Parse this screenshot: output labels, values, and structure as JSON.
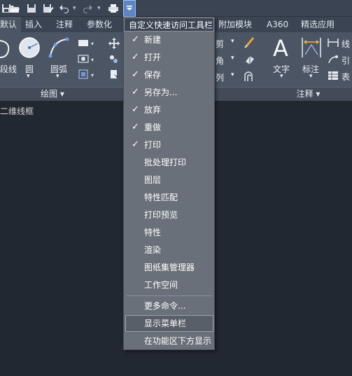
{
  "quick_access": {
    "icons": [
      "save-icon",
      "open-icon",
      "save-as-icon",
      "undo-icon",
      "redo-icon",
      "plot-icon"
    ],
    "dropdown_icon": "chevron-down-icon"
  },
  "tabs": [
    {
      "label": "默认"
    },
    {
      "label": "插入"
    },
    {
      "label": "注释"
    },
    {
      "label": "参数化"
    },
    {
      "label": "附加模块"
    },
    {
      "label": "A360"
    },
    {
      "label": "精选应用"
    }
  ],
  "ribbon": {
    "draw": {
      "polyline_label": "段线",
      "circle_label": "圆",
      "arc_label": "圆弧",
      "panel_label": "绘图 ▾"
    },
    "modify": {
      "trim_label": "剪",
      "fillet_label": "角",
      "array_label": "列"
    },
    "annotation": {
      "text_label": "文字",
      "dimension_label": "标注",
      "linear_label": "线",
      "leader_label": "引",
      "table_label": "表",
      "panel_label": "注释 ▾"
    }
  },
  "canvas": {
    "view_label": "二维线框"
  },
  "menu": {
    "title": "自定义快速访问工具栏",
    "items": [
      {
        "label": "新建",
        "checked": "✓"
      },
      {
        "label": "打开",
        "checked": "✓"
      },
      {
        "label": "保存",
        "checked": "✓"
      },
      {
        "label": "另存为...",
        "checked": "✓"
      },
      {
        "label": "放弃",
        "checked": "✓"
      },
      {
        "label": "重做",
        "checked": "✓"
      },
      {
        "label": "打印",
        "checked": "✓"
      },
      {
        "label": "批处理打印",
        "checked": ""
      },
      {
        "label": "图层",
        "checked": ""
      },
      {
        "label": "特性匹配",
        "checked": ""
      },
      {
        "label": "打印预览",
        "checked": ""
      },
      {
        "label": "特性",
        "checked": ""
      },
      {
        "label": "渲染",
        "checked": ""
      },
      {
        "label": "图纸集管理器",
        "checked": ""
      },
      {
        "label": "工作空间",
        "checked": ""
      }
    ],
    "more_commands": "更多命令...",
    "show_menubar": "显示菜单栏",
    "show_below_ribbon": "在功能区下方显示"
  }
}
